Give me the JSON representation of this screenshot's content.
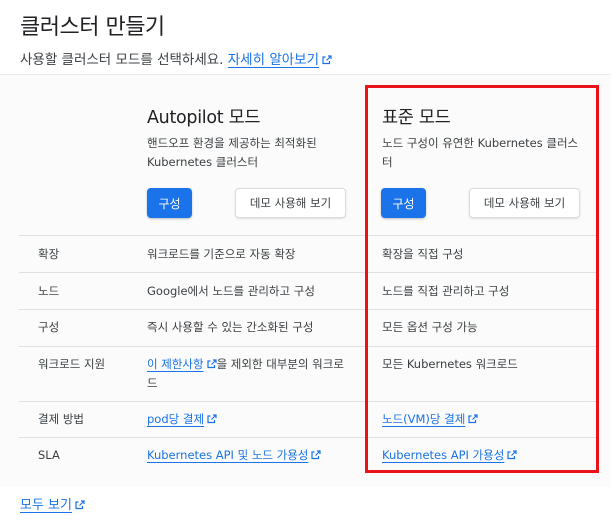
{
  "header": {
    "title": "클러스터 만들기",
    "subtitle": "사용할 클러스터 모드를 선택하세요.",
    "learn_more": "자세히 알아보기"
  },
  "columns": {
    "autopilot": {
      "title": "Autopilot 모드",
      "description": "핸드오프 환경을 제공하는 최적화된 Kubernetes 클러스터",
      "configure_label": "구성",
      "demo_label": "데모 사용해 보기"
    },
    "standard": {
      "title": "표준 모드",
      "description": "노드 구성이 유연한 Kubernetes 클러스터",
      "configure_label": "구성",
      "demo_label": "데모 사용해 보기"
    }
  },
  "rows": [
    {
      "label": "확장",
      "autopilot": "워크로드를 기준으로 자동 확장",
      "standard": "확장을 직접 구성"
    },
    {
      "label": "노드",
      "autopilot": "Google에서 노드를 관리하고 구성",
      "standard": "노드를 직접 관리하고 구성"
    },
    {
      "label": "구성",
      "autopilot": "즉시 사용할 수 있는 간소화된 구성",
      "standard": "모든 옵션 구성 가능"
    },
    {
      "label": "워크로드 지원",
      "autopilot_link": "이 제한사항",
      "autopilot_rest": "을 제외한 대부분의 워크로드",
      "standard": "모든 Kubernetes 워크로드"
    },
    {
      "label": "결제 방법",
      "autopilot_link": "pod당 결제",
      "standard_link": "노드(VM)당 결제"
    },
    {
      "label": "SLA",
      "autopilot_link": "Kubernetes API 및 노드 가용성",
      "standard_link": "Kubernetes API 가용성"
    }
  ],
  "footer": {
    "see_all": "모두 보기"
  },
  "colors": {
    "accent": "#1a73e8",
    "highlight": "#e8141a",
    "text": "#3c4043"
  },
  "icons": {
    "external": "external-link-icon"
  }
}
